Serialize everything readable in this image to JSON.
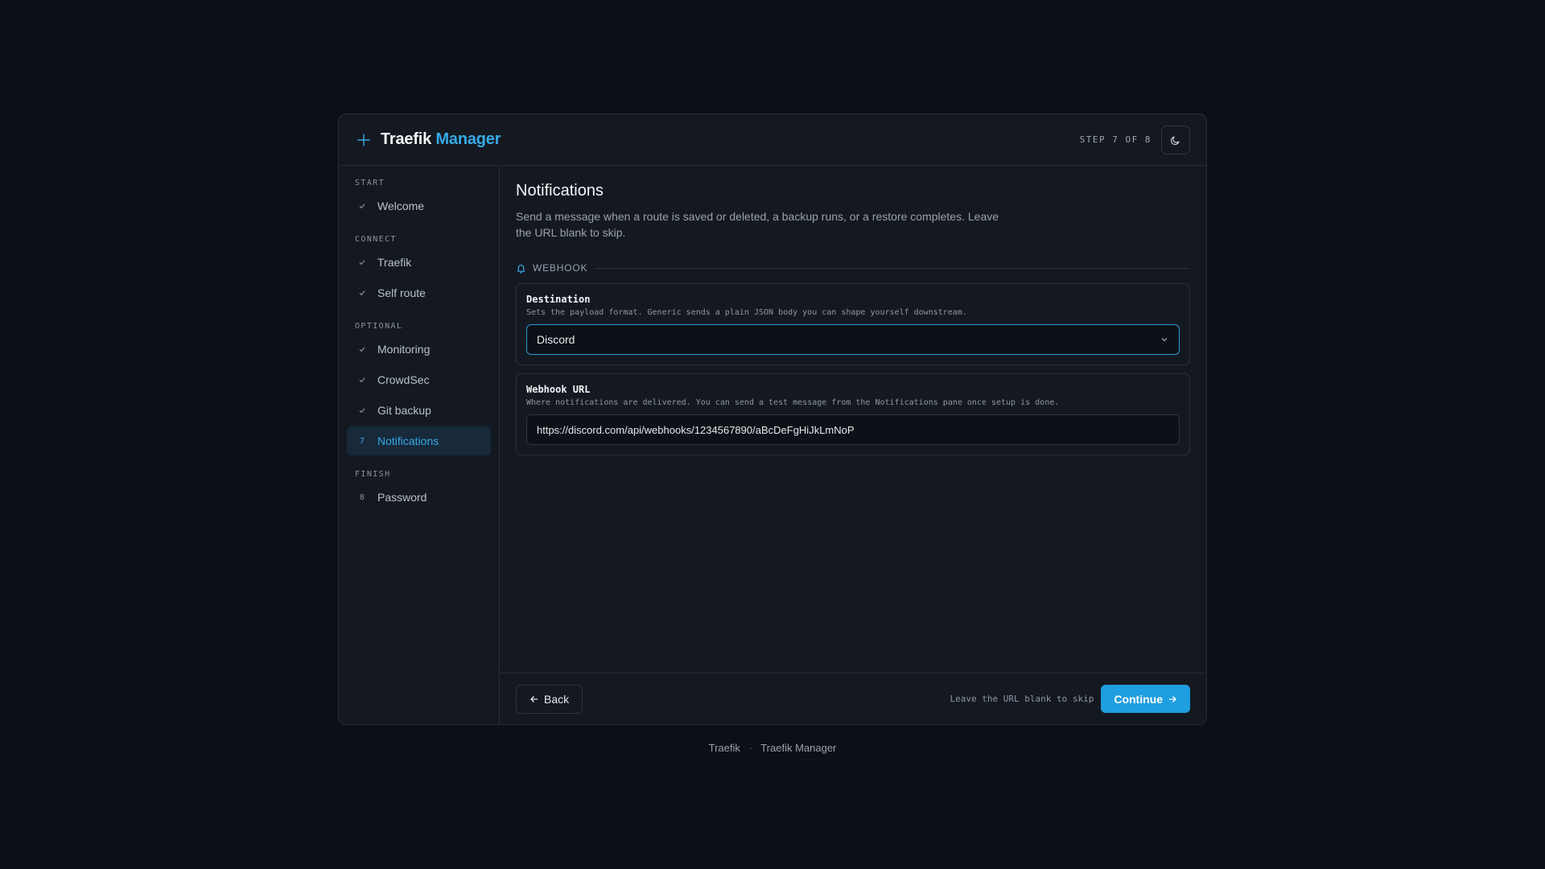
{
  "colors": {
    "accent": "#38a9e6",
    "primary_button": "#1e9ee0",
    "background": "#0b0f16",
    "card": "#141921"
  },
  "header": {
    "brand_part1": "Traefik",
    "brand_part2": "Manager",
    "brand_icon": "sparkle-icon",
    "step": "STEP 7 OF 8",
    "theme_icon": "moon-icon"
  },
  "sidebar": {
    "groups": [
      {
        "label": "START",
        "items": [
          {
            "label": "Welcome",
            "marker": "check"
          }
        ]
      },
      {
        "label": "CONNECT",
        "items": [
          {
            "label": "Traefik",
            "marker": "check"
          },
          {
            "label": "Self route",
            "marker": "check"
          }
        ]
      },
      {
        "label": "OPTIONAL",
        "items": [
          {
            "label": "Monitoring",
            "marker": "check"
          },
          {
            "label": "CrowdSec",
            "marker": "check"
          },
          {
            "label": "Git backup",
            "marker": "check"
          },
          {
            "label": "Notifications",
            "marker": "7",
            "active": true
          }
        ]
      },
      {
        "label": "FINISH",
        "items": [
          {
            "label": "Password",
            "marker": "8"
          }
        ]
      }
    ]
  },
  "main": {
    "title": "Notifications",
    "description": "Send a message when a route is saved or deleted, a backup runs, or a restore completes. Leave the URL blank to skip.",
    "section": {
      "label": "WEBHOOK",
      "icon": "bell-icon"
    },
    "destination": {
      "title": "Destination",
      "help": "Sets the payload format. Generic sends a plain JSON body you can shape yourself downstream.",
      "value": "Discord"
    },
    "webhook": {
      "title": "Webhook URL",
      "help": "Where notifications are delivered. You can send a test message from the Notifications pane once setup is done.",
      "value": "https://discord.com/api/webhooks/1234567890/aBcDeFgHiJkLmNoP"
    }
  },
  "footer": {
    "back_label": "Back",
    "skip_hint": "Leave the URL blank to skip",
    "continue_label": "Continue"
  },
  "page_footer": {
    "left": "Traefik",
    "sep": "·",
    "right": "Traefik Manager"
  }
}
